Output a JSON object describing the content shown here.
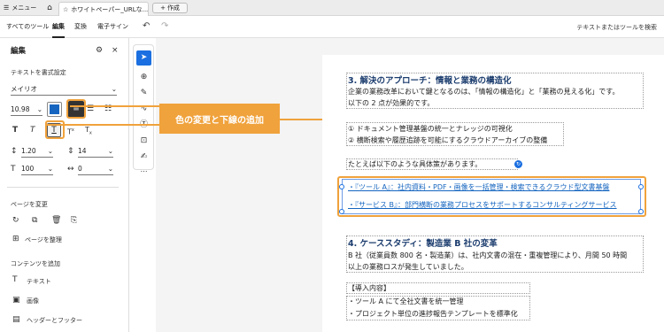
{
  "tabbar": {
    "menu_label": "メニュー",
    "doc_tab_label": "ホワイトペーパー_URLな...",
    "new_tab_label": "作成"
  },
  "toolbar": {
    "tabs": [
      "すべてのツール",
      "編集",
      "変換",
      "電子サイン"
    ],
    "active_tab": "編集",
    "search_label": "テキストまたはツールを検索"
  },
  "panel": {
    "title": "編集",
    "text_format_heading": "テキストを書式設定",
    "font_family": "メイリオ",
    "font_size": "10.98",
    "text_color": "#1565c0",
    "line_spacing": "1.20",
    "paragraph_spacing": "14",
    "char_scale": "100",
    "char_spacing": "0",
    "page_change_heading": "ページを変更",
    "manage_pages_label": "ページを整理",
    "add_content_heading": "コンテンツを追加",
    "add_text_label": "テキスト",
    "add_image_label": "画像",
    "header_footer_label": "ヘッダーとフッター"
  },
  "callout": {
    "text": "色の変更と下線の追加",
    "color": "#f0a23c"
  },
  "doc": {
    "section3_title": "3. 解決のアプローチ：情報と業務の構造化",
    "section3_line1": "企業の業務改革において鍵となるのは、「情報の構造化」と「業務の見える化」です。",
    "section3_line2": "以下の 2 点が効果的です。",
    "list_item1": "① ドキュメント管理基盤の統一とナレッジの可視化",
    "list_item2": "② 横断検索や履歴追跡を可能にするクラウドアーカイブの整備",
    "examples_intro": "たとえば以下のような具体策があります。",
    "bullet1": "・『ツール A』：社内資料・PDF・画像を一括管理・検索できるクラウド型文書基盤",
    "bullet2": "・『サービス B』：部門横断の業務プロセスをサポートするコンサルティングサービス",
    "section4_title": "4. ケーススタディ：製造業 B 社の変革",
    "section4_line1": "B 社（従業員数 800 名・製造業）は、社内文書の混在・重複管理により、月間 50 時間",
    "section4_line2": "以上の業務ロスが発生していました。",
    "intro_heading": "【導入内容】",
    "intro_item1": "・ツール A にて全社文書を統一管理",
    "intro_item2": "・プロジェクト単位の進捗報告テンプレートを標準化"
  }
}
